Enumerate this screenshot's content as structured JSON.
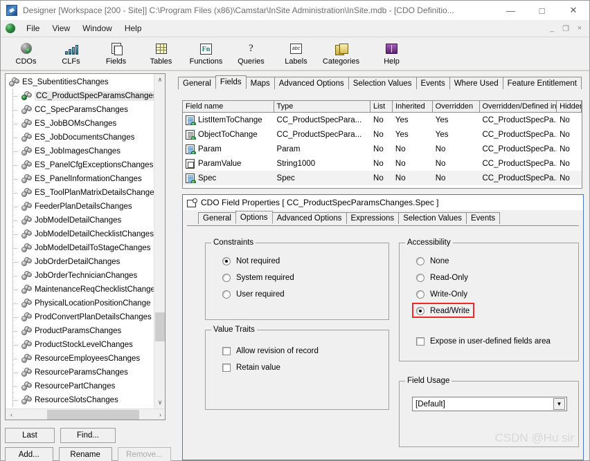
{
  "window": {
    "title": "Designer [Workspace [200 - Site]]  C:\\Program Files (x86)\\Camstar\\InSite Administration\\InSite.mdb - [CDO Definitio...",
    "icon": "app-icon",
    "controls": {
      "minimize": "—",
      "maximize": "□",
      "close": "✕"
    },
    "mdi_controls": {
      "minimize": "_",
      "restore": "❐",
      "close": "×"
    }
  },
  "menubar": {
    "globe_icon": "globe-icon",
    "items": [
      {
        "label": "File"
      },
      {
        "label": "View"
      },
      {
        "label": "Window"
      },
      {
        "label": "Help"
      }
    ]
  },
  "toolbar": {
    "buttons": [
      {
        "label": "CDOs",
        "icon": "cdo-globe-icon"
      },
      {
        "label": "CLFs",
        "icon": "clf-bars-icon"
      },
      {
        "label": "Fields",
        "icon": "fields-document-icon"
      },
      {
        "label": "Tables",
        "icon": "tables-grid-icon"
      },
      {
        "label": "Functions",
        "icon": "functions-fn-icon",
        "glyph": "Fn"
      },
      {
        "label": "Queries",
        "icon": "queries-question-icon",
        "glyph": "?"
      },
      {
        "label": "Labels",
        "icon": "labels-abc-icon",
        "glyph": "abc"
      },
      {
        "label": "Categories",
        "icon": "categories-folder-icon"
      },
      {
        "label": "Help",
        "icon": "help-book-icon"
      }
    ]
  },
  "tree": {
    "root": {
      "label": "ES_SubentitiesChanges",
      "icon": "cdo-icon"
    },
    "items": [
      {
        "label": "CC_ProductSpecParamsChanges",
        "selected": true
      },
      {
        "label": "CC_SpecParamsChanges",
        "selected": false
      },
      {
        "label": "ES_JobBOMsChanges",
        "selected": false
      },
      {
        "label": "ES_JobDocumentsChanges",
        "selected": false
      },
      {
        "label": "ES_JobImagesChanges",
        "selected": false
      },
      {
        "label": "ES_PanelCfgExceptionsChanges",
        "selected": false
      },
      {
        "label": "ES_PanelInformationChanges",
        "selected": false
      },
      {
        "label": "ES_ToolPlanMatrixDetailsChange",
        "selected": false
      },
      {
        "label": "FeederPlanDetailsChanges",
        "selected": false
      },
      {
        "label": "JobModelDetailChanges",
        "selected": false
      },
      {
        "label": "JobModelDetailChecklistChanges",
        "selected": false
      },
      {
        "label": "JobModelDetailToStageChanges",
        "selected": false
      },
      {
        "label": "JobOrderDetailChanges",
        "selected": false
      },
      {
        "label": "JobOrderTechnicianChanges",
        "selected": false
      },
      {
        "label": "MaintenanceReqChecklistChanges",
        "selected": false
      },
      {
        "label": "PhysicalLocationPositionChange",
        "selected": false
      },
      {
        "label": "ProdConvertPlanDetailsChanges",
        "selected": false
      },
      {
        "label": "ProductParamsChanges",
        "selected": false
      },
      {
        "label": "ProductStockLevelChanges",
        "selected": false
      },
      {
        "label": "ResourceEmployeesChanges",
        "selected": false
      },
      {
        "label": "ResourceParamsChanges",
        "selected": false
      },
      {
        "label": "ResourcePartChanges",
        "selected": false
      },
      {
        "label": "ResourceSlotsChanges",
        "selected": false
      }
    ],
    "scroll": {
      "up": "∧",
      "down": "∨",
      "left": "‹",
      "right": "›"
    }
  },
  "bottom_buttons": [
    {
      "label": "Last",
      "accel": "L",
      "disabled": false
    },
    {
      "label": "Find...",
      "accel": "F",
      "disabled": false
    },
    {
      "label": "Add...",
      "accel": "A",
      "disabled": false
    },
    {
      "label": "Rename",
      "accel": "n",
      "disabled": false
    },
    {
      "label": "Remove...",
      "accel": "R",
      "disabled": true
    }
  ],
  "main_tabs": [
    {
      "label": "General",
      "active": false
    },
    {
      "label": "Fields",
      "active": true
    },
    {
      "label": "Maps",
      "active": false
    },
    {
      "label": "Advanced Options",
      "active": false
    },
    {
      "label": "Selection Values",
      "active": false
    },
    {
      "label": "Events",
      "active": false
    },
    {
      "label": "Where Used",
      "active": false
    },
    {
      "label": "Feature Entitlement",
      "active": false
    }
  ],
  "field_grid": {
    "columns": [
      "Field name",
      "Type",
      "List",
      "Inherited",
      "Overridden",
      "Overridden/Defined in",
      "Hidden"
    ],
    "rows": [
      {
        "name": "ListItemToChange",
        "type": "CC_ProductSpecPara...",
        "list": "No",
        "inherited": "Yes",
        "overridden": "Yes",
        "defined_in": "CC_ProductSpecPa...",
        "hidden": "No",
        "icon": "field-icon",
        "selected": false
      },
      {
        "name": "ObjectToChange",
        "type": "CC_ProductSpecPara...",
        "list": "No",
        "inherited": "Yes",
        "overridden": "Yes",
        "defined_in": "CC_ProductSpecPa...",
        "hidden": "No",
        "icon": "field-icon",
        "selected": false
      },
      {
        "name": "Param",
        "type": "Param",
        "list": "No",
        "inherited": "No",
        "overridden": "No",
        "defined_in": "CC_ProductSpecPa...",
        "hidden": "No",
        "icon": "field-icon",
        "selected": false
      },
      {
        "name": "ParamValue",
        "type": "String1000",
        "list": "No",
        "inherited": "No",
        "overridden": "No",
        "defined_in": "CC_ProductSpecPa...",
        "hidden": "No",
        "icon": "field-icon-plain",
        "selected": false
      },
      {
        "name": "Spec",
        "type": "Spec",
        "list": "No",
        "inherited": "No",
        "overridden": "No",
        "defined_in": "CC_ProductSpecPa...",
        "hidden": "No",
        "icon": "field-icon",
        "selected": true
      }
    ]
  },
  "properties": {
    "title": "CDO Field Properties [ CC_ProductSpecParamsChanges.Spec ]",
    "title_icon": "properties-icon",
    "tabs": [
      {
        "label": "General",
        "active": false
      },
      {
        "label": "Options",
        "active": true
      },
      {
        "label": "Advanced Options",
        "active": false
      },
      {
        "label": "Expressions",
        "active": false
      },
      {
        "label": "Selection Values",
        "active": false
      },
      {
        "label": "Events",
        "active": false
      }
    ],
    "constraints": {
      "title": "Constraints",
      "options": [
        {
          "label": "Not required",
          "checked": true
        },
        {
          "label": "System required",
          "checked": false
        },
        {
          "label": "User required",
          "checked": false
        }
      ]
    },
    "value_traits": {
      "title": "Value Traits",
      "options": [
        {
          "label": "Allow revision of record",
          "checked": false
        },
        {
          "label": "Retain value",
          "checked": false
        }
      ]
    },
    "accessibility": {
      "title": "Accessibility",
      "options": [
        {
          "label": "None",
          "checked": false,
          "highlighted": false
        },
        {
          "label": "Read-Only",
          "checked": false,
          "highlighted": false
        },
        {
          "label": "Write-Only",
          "checked": false,
          "highlighted": false
        },
        {
          "label": "Read/Write",
          "checked": true,
          "highlighted": true
        }
      ],
      "expose_checkbox": {
        "label": "Expose in user-defined fields area",
        "checked": false
      },
      "highlight_color": "#f4262a"
    },
    "field_usage": {
      "title": "Field Usage",
      "value": "[Default]",
      "arrow": "▼"
    }
  },
  "watermark": "CSDN @Hu  sir"
}
